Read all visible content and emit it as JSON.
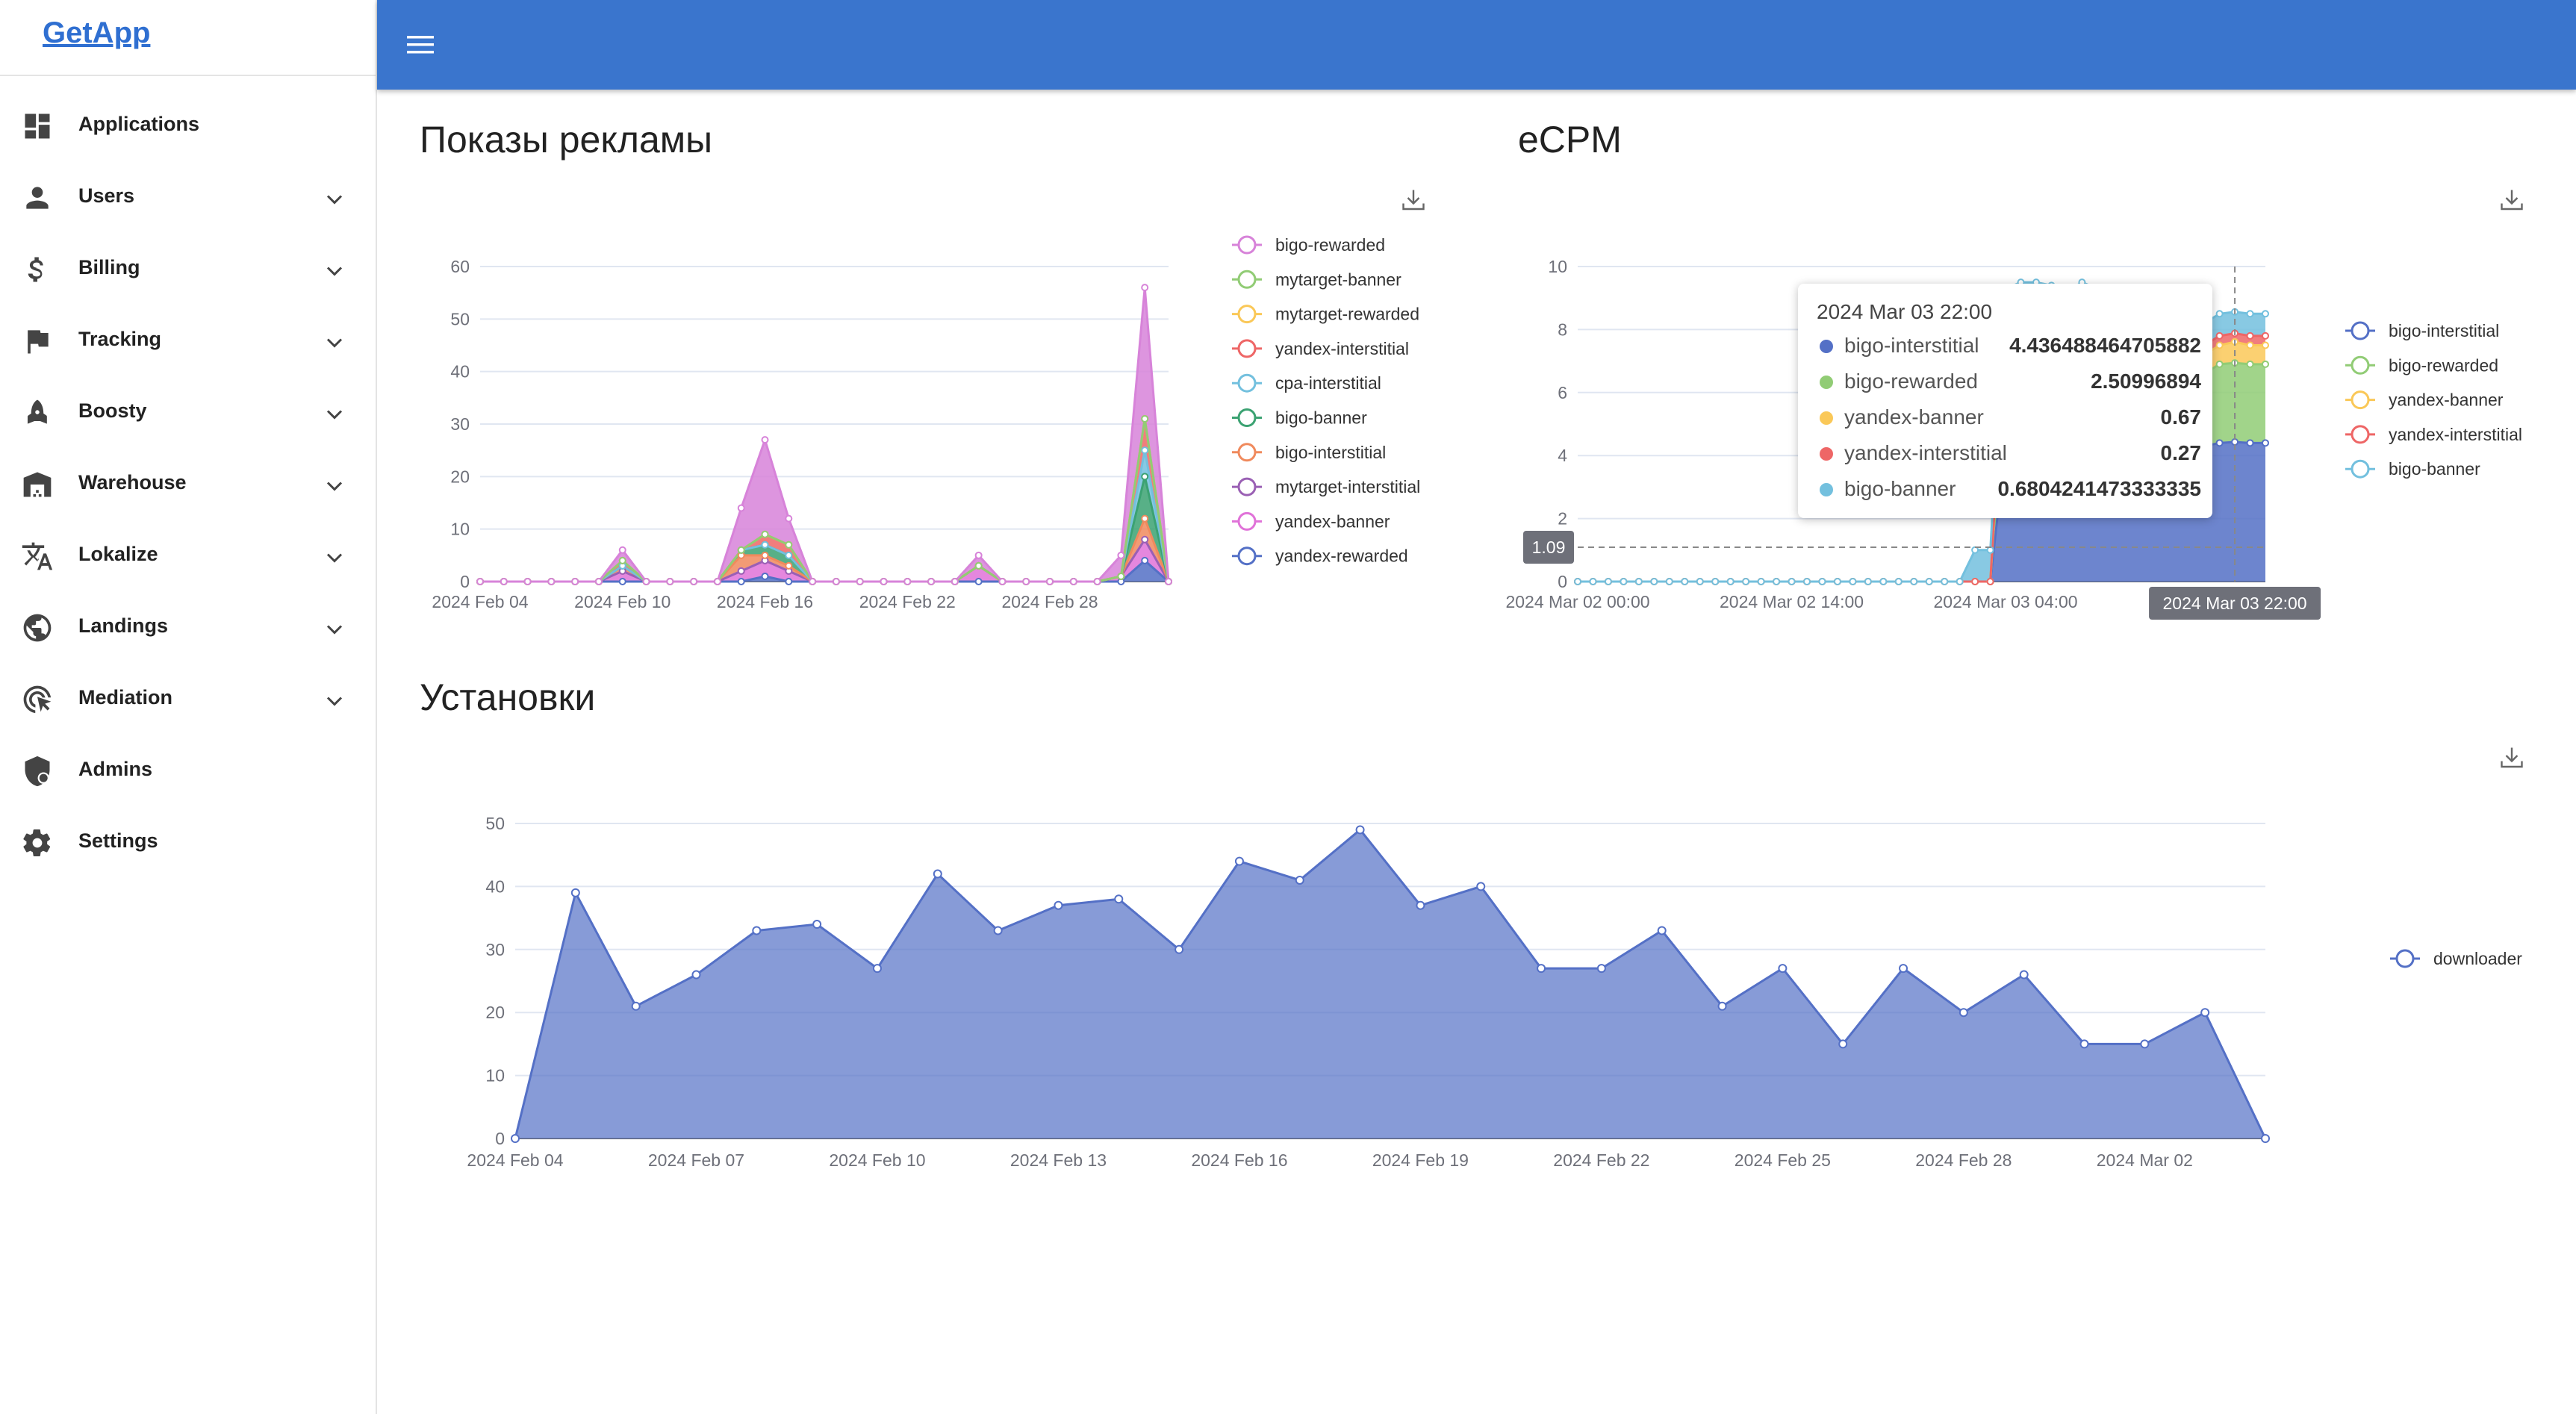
{
  "app": {
    "title": "GetApp"
  },
  "sidebar": {
    "items": [
      {
        "label": "Applications",
        "icon": "dashboard-icon",
        "expandable": false
      },
      {
        "label": "Users",
        "icon": "person-icon",
        "expandable": true
      },
      {
        "label": "Billing",
        "icon": "dollar-icon",
        "expandable": true
      },
      {
        "label": "Tracking",
        "icon": "flag-icon",
        "expandable": true
      },
      {
        "label": "Boosty",
        "icon": "rocket-icon",
        "expandable": true
      },
      {
        "label": "Warehouse",
        "icon": "warehouse-icon",
        "expandable": true
      },
      {
        "label": "Lokalize",
        "icon": "translate-icon",
        "expandable": true
      },
      {
        "label": "Landings",
        "icon": "globe-icon",
        "expandable": true
      },
      {
        "label": "Mediation",
        "icon": "target-cursor-icon",
        "expandable": true
      },
      {
        "label": "Admins",
        "icon": "admin-shield-icon",
        "expandable": false
      },
      {
        "label": "Settings",
        "icon": "gear-icon",
        "expandable": false
      }
    ]
  },
  "colors": {
    "topbar": "#3a75cd",
    "accent": "#5470c6"
  },
  "sections": {
    "impressions": {
      "title": "Показы рекламы"
    },
    "ecpm": {
      "title": "eCPM"
    },
    "installs": {
      "title": "Установки"
    }
  },
  "chart_data": [
    {
      "id": "impressions",
      "type": "area",
      "stacked": true,
      "title": "Показы рекламы",
      "x": [
        "2024 Feb 04",
        "2024 Feb 05",
        "2024 Feb 06",
        "2024 Feb 07",
        "2024 Feb 08",
        "2024 Feb 09",
        "2024 Feb 10",
        "2024 Feb 11",
        "2024 Feb 12",
        "2024 Feb 13",
        "2024 Feb 14",
        "2024 Feb 15",
        "2024 Feb 16",
        "2024 Feb 17",
        "2024 Feb 18",
        "2024 Feb 19",
        "2024 Feb 20",
        "2024 Feb 21",
        "2024 Feb 22",
        "2024 Feb 23",
        "2024 Feb 24",
        "2024 Feb 25",
        "2024 Feb 26",
        "2024 Feb 27",
        "2024 Feb 28",
        "2024 Feb 29",
        "2024 Mar 01",
        "2024 Mar 02",
        "2024 Mar 03",
        "2024 Mar 04"
      ],
      "x_ticks": [
        "2024 Feb 04",
        "2024 Feb 10",
        "2024 Feb 16",
        "2024 Feb 22",
        "2024 Feb 28"
      ],
      "ylim": [
        0,
        60
      ],
      "y_ticks": [
        0,
        10,
        20,
        30,
        40,
        50,
        60
      ],
      "legend_position": "right",
      "series": [
        {
          "name": "yandex-rewarded",
          "color": "#5470c6",
          "values": [
            0,
            0,
            0,
            0,
            0,
            0,
            0,
            0,
            0,
            0,
            0,
            0,
            1,
            0,
            0,
            0,
            0,
            0,
            0,
            0,
            0,
            0,
            0,
            0,
            0,
            0,
            0,
            0,
            4,
            0
          ]
        },
        {
          "name": "yandex-banner",
          "color": "#e072d8",
          "values": [
            0,
            0,
            0,
            0,
            0,
            0,
            2,
            0,
            0,
            0,
            0,
            2,
            3,
            2,
            0,
            0,
            0,
            0,
            0,
            0,
            0,
            3,
            0,
            0,
            0,
            0,
            0,
            1,
            4,
            0
          ]
        },
        {
          "name": "mytarget-interstitial",
          "color": "#9a60b4",
          "values": [
            0,
            0,
            0,
            0,
            0,
            0,
            0,
            0,
            0,
            0,
            0,
            0,
            0,
            0,
            0,
            0,
            0,
            0,
            0,
            0,
            0,
            0,
            0,
            0,
            0,
            0,
            0,
            0,
            0,
            0
          ]
        },
        {
          "name": "bigo-interstitial",
          "color": "#f08a5d",
          "values": [
            0,
            0,
            0,
            0,
            0,
            0,
            1,
            0,
            0,
            0,
            0,
            3,
            1,
            1,
            0,
            0,
            0,
            0,
            0,
            0,
            0,
            0,
            0,
            0,
            0,
            0,
            0,
            0,
            4,
            0
          ]
        },
        {
          "name": "bigo-banner",
          "color": "#3ba272",
          "values": [
            0,
            0,
            0,
            0,
            0,
            0,
            0,
            0,
            0,
            0,
            0,
            1,
            2,
            2,
            0,
            0,
            0,
            0,
            0,
            0,
            0,
            0,
            0,
            0,
            0,
            0,
            0,
            0,
            8,
            0
          ]
        },
        {
          "name": "cpa-interstitial",
          "color": "#73c0de",
          "values": [
            0,
            0,
            0,
            0,
            0,
            0,
            0,
            0,
            0,
            0,
            0,
            0,
            0,
            0,
            0,
            0,
            0,
            0,
            0,
            0,
            0,
            0,
            0,
            0,
            0,
            0,
            0,
            0,
            5,
            0
          ]
        },
        {
          "name": "yandex-interstitial",
          "color": "#ee6666",
          "values": [
            0,
            0,
            0,
            0,
            0,
            0,
            1,
            0,
            0,
            0,
            0,
            0,
            2,
            2,
            0,
            0,
            0,
            0,
            0,
            0,
            0,
            0,
            0,
            0,
            0,
            0,
            0,
            0,
            6,
            0
          ]
        },
        {
          "name": "mytarget-rewarded",
          "color": "#fac858",
          "values": [
            0,
            0,
            0,
            0,
            0,
            0,
            0,
            0,
            0,
            0,
            0,
            0,
            0,
            0,
            0,
            0,
            0,
            0,
            0,
            0,
            0,
            0,
            0,
            0,
            0,
            0,
            0,
            0,
            0,
            0
          ]
        },
        {
          "name": "mytarget-banner",
          "color": "#91cc75",
          "values": [
            0,
            0,
            0,
            0,
            0,
            0,
            0,
            0,
            0,
            0,
            0,
            0,
            0,
            0,
            0,
            0,
            0,
            0,
            0,
            0,
            0,
            0,
            0,
            0,
            0,
            0,
            0,
            0,
            0,
            0
          ]
        },
        {
          "name": "bigo-rewarded",
          "color": "#d783d9",
          "values": [
            0,
            0,
            0,
            0,
            0,
            0,
            2,
            0,
            0,
            0,
            0,
            8,
            18,
            5,
            0,
            0,
            0,
            0,
            0,
            0,
            0,
            2,
            0,
            0,
            0,
            0,
            0,
            4,
            25,
            0
          ]
        }
      ],
      "legend_order": [
        "bigo-rewarded",
        "mytarget-banner",
        "mytarget-rewarded",
        "yandex-interstitial",
        "cpa-interstitial",
        "bigo-banner",
        "bigo-interstitial",
        "mytarget-interstitial",
        "yandex-banner",
        "yandex-rewarded"
      ]
    },
    {
      "id": "ecpm",
      "type": "area",
      "stacked": true,
      "title": "eCPM",
      "x_ticks": [
        "2024 Mar 02 00:00",
        "2024 Mar 02 14:00",
        "2024 Mar 03 04:00",
        "2024"
      ],
      "ylim": [
        0,
        10
      ],
      "y_ticks": [
        0,
        2,
        4,
        6,
        8,
        10
      ],
      "legend_position": "right",
      "n_points": 46,
      "x_start": "2024 Mar 02 00:00",
      "x_step_hours": 1,
      "series": [
        {
          "name": "bigo-interstitial",
          "color": "#5470c6",
          "values": [
            0,
            0,
            0,
            0,
            0,
            0,
            0,
            0,
            0,
            0,
            0,
            0,
            0,
            0,
            0,
            0,
            0,
            0,
            0,
            0,
            0,
            0,
            0,
            0,
            0,
            0,
            0,
            0,
            4.4,
            4.6,
            4.5,
            4.3,
            4.5,
            4.6,
            4.4,
            4.5,
            4.3,
            4.4,
            4.0,
            4.1,
            4.2,
            4.3,
            4.4,
            4.43,
            4.4,
            4.4
          ]
        },
        {
          "name": "bigo-rewarded",
          "color": "#91cc75",
          "values": [
            0,
            0,
            0,
            0,
            0,
            0,
            0,
            0,
            0,
            0,
            0,
            0,
            0,
            0,
            0,
            0,
            0,
            0,
            0,
            0,
            0,
            0,
            0,
            0,
            0,
            0,
            0,
            0,
            3.0,
            3.0,
            3.0,
            3.2,
            2.8,
            3.0,
            3.0,
            2.9,
            3.0,
            2.8,
            2.0,
            2.1,
            2.2,
            2.3,
            2.5,
            2.51,
            2.5,
            2.5
          ]
        },
        {
          "name": "yandex-banner",
          "color": "#fac858",
          "values": [
            0,
            0,
            0,
            0,
            0,
            0,
            0,
            0,
            0,
            0,
            0,
            0,
            0,
            0,
            0,
            0,
            0,
            0,
            0,
            0,
            0,
            0,
            0,
            0,
            0,
            0,
            0,
            0,
            0.6,
            0.6,
            0.6,
            0.6,
            0.6,
            0.6,
            0.6,
            0.6,
            0.6,
            0.6,
            0.6,
            0.6,
            0.6,
            0.6,
            0.6,
            0.67,
            0.6,
            0.6
          ]
        },
        {
          "name": "yandex-interstitial",
          "color": "#ee6666",
          "values": [
            0,
            0,
            0,
            0,
            0,
            0,
            0,
            0,
            0,
            0,
            0,
            0,
            0,
            0,
            0,
            0,
            0,
            0,
            0,
            0,
            0,
            0,
            0,
            0,
            0,
            0,
            0,
            0,
            0.3,
            0.3,
            0.3,
            0.3,
            0.3,
            0.3,
            0.3,
            0.3,
            0.3,
            0.3,
            0.3,
            0.3,
            0.3,
            0.3,
            0.3,
            0.27,
            0.3,
            0.3
          ]
        },
        {
          "name": "bigo-banner",
          "color": "#73c0de",
          "values": [
            0,
            0,
            0,
            0,
            0,
            0,
            0,
            0,
            0,
            0,
            0,
            0,
            0,
            0,
            0,
            0,
            0,
            0,
            0,
            0,
            0,
            0,
            0,
            0,
            0,
            0,
            1.0,
            1.0,
            1.0,
            1.0,
            1.1,
            1.0,
            1.0,
            1.0,
            1.0,
            1.0,
            1.0,
            1.0,
            0.8,
            0.8,
            0.7,
            0.7,
            0.7,
            0.68,
            0.7,
            0.7
          ]
        }
      ],
      "legend_order": [
        "bigo-interstitial",
        "bigo-rewarded",
        "yandex-banner",
        "yandex-interstitial",
        "bigo-banner"
      ],
      "crosshair": {
        "y_label": "1.09",
        "x_label": "2024 Mar 03 22:00",
        "index": 43
      },
      "tooltip": {
        "title": "2024 Mar 03 22:00",
        "rows": [
          {
            "name": "bigo-interstitial",
            "value": "4.436488464705882",
            "color": "#5470c6"
          },
          {
            "name": "bigo-rewarded",
            "value": "2.50996894",
            "color": "#91cc75"
          },
          {
            "name": "yandex-banner",
            "value": "0.67",
            "color": "#fac858"
          },
          {
            "name": "yandex-interstitial",
            "value": "0.27",
            "color": "#ee6666"
          },
          {
            "name": "bigo-banner",
            "value": "0.6804241473333335",
            "color": "#73c0de"
          }
        ]
      }
    },
    {
      "id": "installs",
      "type": "area",
      "title": "Установки",
      "x": [
        "2024 Feb 04",
        "2024 Feb 05",
        "2024 Feb 06",
        "2024 Feb 07",
        "2024 Feb 08",
        "2024 Feb 09",
        "2024 Feb 10",
        "2024 Feb 11",
        "2024 Feb 12",
        "2024 Feb 13",
        "2024 Feb 14",
        "2024 Feb 15",
        "2024 Feb 16",
        "2024 Feb 17",
        "2024 Feb 18",
        "2024 Feb 19",
        "2024 Feb 20",
        "2024 Feb 21",
        "2024 Feb 22",
        "2024 Feb 23",
        "2024 Feb 24",
        "2024 Feb 25",
        "2024 Feb 26",
        "2024 Feb 27",
        "2024 Feb 28",
        "2024 Feb 29",
        "2024 Mar 01",
        "2024 Mar 02",
        "2024 Mar 03",
        "2024 Mar 04"
      ],
      "x_ticks": [
        "2024 Feb 04",
        "2024 Feb 07",
        "2024 Feb 10",
        "2024 Feb 13",
        "2024 Feb 16",
        "2024 Feb 19",
        "2024 Feb 22",
        "2024 Feb 25",
        "2024 Feb 28",
        "2024 Mar 02"
      ],
      "ylim": [
        0,
        50
      ],
      "y_ticks": [
        0,
        10,
        20,
        30,
        40,
        50
      ],
      "legend_position": "right",
      "series": [
        {
          "name": "downloader",
          "color": "#5470c6",
          "values": [
            0,
            39,
            21,
            26,
            33,
            34,
            27,
            42,
            33,
            37,
            38,
            30,
            44,
            41,
            49,
            37,
            40,
            27,
            27,
            33,
            21,
            27,
            15,
            27,
            20,
            26,
            15,
            15,
            20,
            0
          ]
        }
      ]
    }
  ]
}
